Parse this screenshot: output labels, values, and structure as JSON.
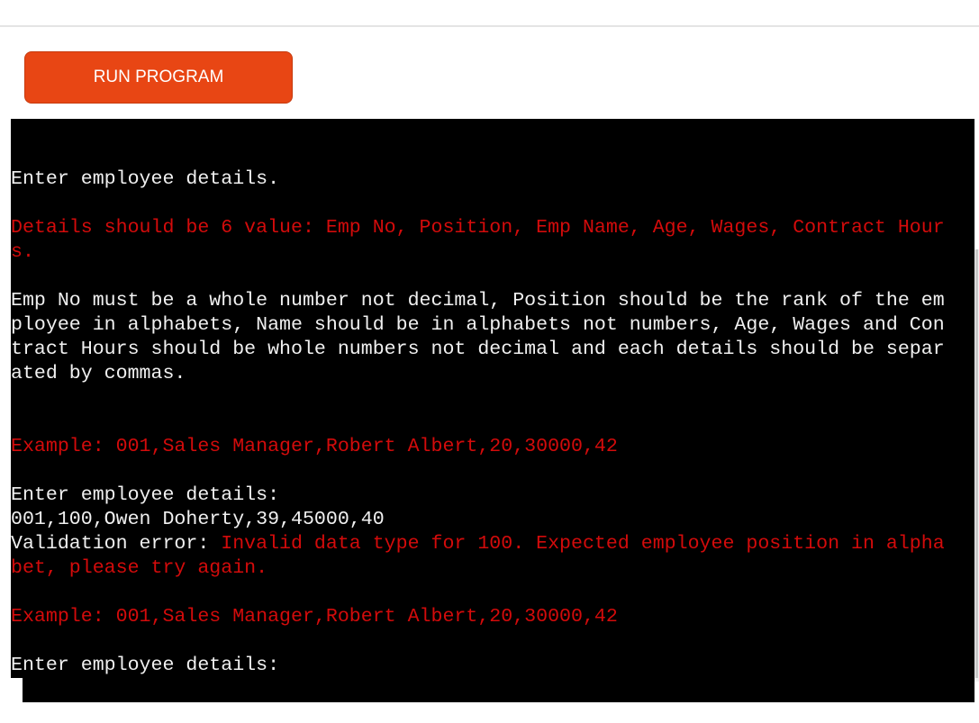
{
  "run_button": {
    "label": "RUN PROGRAM"
  },
  "terminal": {
    "lines": [
      {
        "segments": [
          {
            "text": "Enter employee details.",
            "color": "white"
          }
        ]
      },
      {
        "segments": [
          {
            "text": "Details should be 6 value: Emp No, Position, Emp Name, Age, Wages, Contract Hour",
            "color": "red"
          }
        ]
      },
      {
        "segments": [
          {
            "text": "s.",
            "color": "red"
          }
        ]
      },
      {
        "segments": [
          {
            "text": "Emp No must be a whole number not decimal, Position should be the rank of the em",
            "color": "white"
          }
        ]
      },
      {
        "segments": [
          {
            "text": "ployee in alphabets, Name should be in alphabets not numbers, Age, Wages and Con",
            "color": "white"
          }
        ]
      },
      {
        "segments": [
          {
            "text": "tract Hours should be whole numbers not decimal and each details should be separ",
            "color": "white"
          }
        ]
      },
      {
        "segments": [
          {
            "text": "ated by commas.",
            "color": "white"
          }
        ]
      },
      {
        "segments": [
          {
            "text": "Example: 001,Sales Manager,Robert Albert,20,30000,42",
            "color": "red"
          }
        ]
      },
      {
        "segments": [
          {
            "text": "Enter employee details:",
            "color": "white"
          }
        ]
      },
      {
        "segments": [
          {
            "text": "001,100,Owen Doherty,39,45000,40",
            "color": "white"
          }
        ]
      },
      {
        "segments": [
          {
            "text": "Validation error: ",
            "color": "white"
          },
          {
            "text": "Invalid data type for 100. Expected employee position in alpha",
            "color": "red"
          }
        ]
      },
      {
        "segments": [
          {
            "text": "bet, please try again.",
            "color": "red"
          }
        ]
      },
      {
        "segments": [
          {
            "text": "Example: 001,Sales Manager,Robert Albert,20,30000,42",
            "color": "red"
          }
        ]
      },
      {
        "segments": [
          {
            "text": "Enter employee details:",
            "color": "white"
          }
        ]
      }
    ]
  },
  "colors": {
    "accent": "#e84614",
    "terminal_bg": "#000000",
    "terminal_text": "#f0f0f0",
    "terminal_error": "#d30b0b"
  }
}
